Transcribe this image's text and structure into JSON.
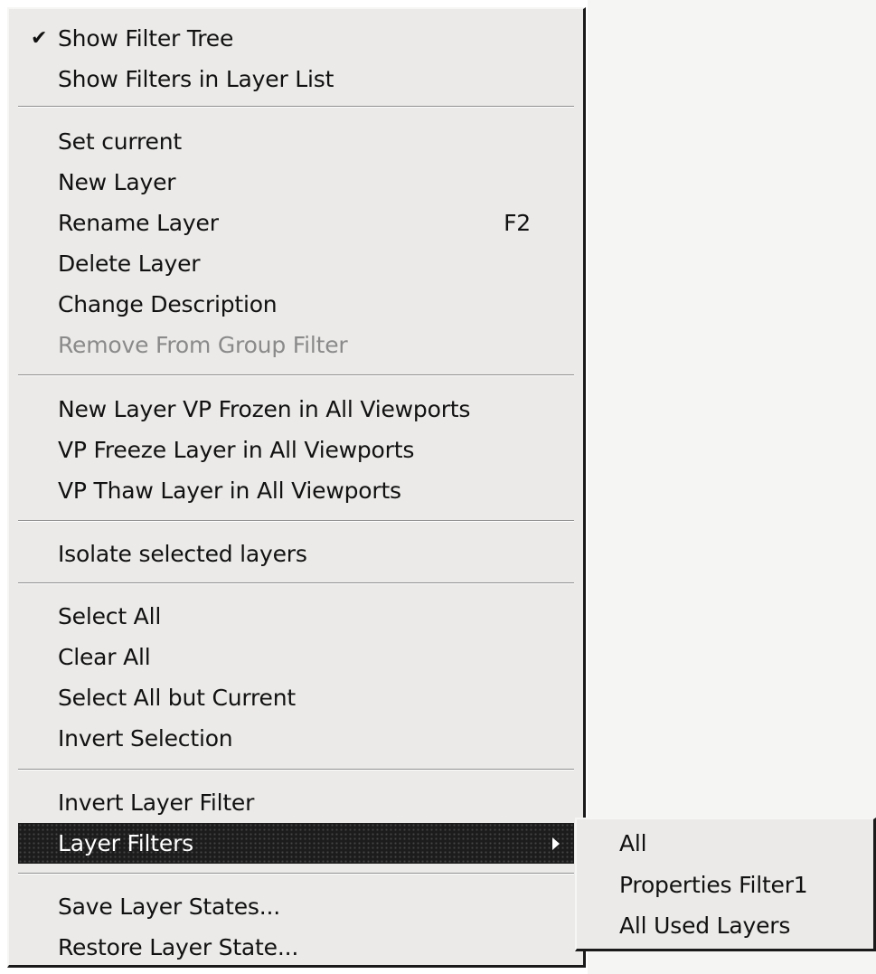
{
  "context_menu": {
    "groups": [
      [
        {
          "label": "Show Filter Tree",
          "checked": true
        },
        {
          "label": "Show Filters in Layer List"
        }
      ],
      [
        {
          "label": "Set current"
        },
        {
          "label": "New Layer"
        },
        {
          "label": "Rename Layer",
          "shortcut": "F2"
        },
        {
          "label": "Delete Layer"
        },
        {
          "label": "Change Description"
        },
        {
          "label": "Remove From Group Filter",
          "disabled": true
        }
      ],
      [
        {
          "label": "New Layer VP Frozen in All Viewports"
        },
        {
          "label": "VP Freeze Layer in All Viewports"
        },
        {
          "label": "VP Thaw Layer in All Viewports"
        }
      ],
      [
        {
          "label": "Isolate selected layers"
        }
      ],
      [
        {
          "label": "Select All"
        },
        {
          "label": "Clear All"
        },
        {
          "label": "Select All but Current"
        },
        {
          "label": "Invert Selection"
        }
      ],
      [
        {
          "label": "Invert Layer Filter"
        },
        {
          "label": "Layer Filters",
          "highlighted": true,
          "has_submenu": true
        }
      ],
      [
        {
          "label": "Save Layer States..."
        },
        {
          "label": "Restore Layer State..."
        }
      ]
    ],
    "checkmark": "✔"
  },
  "submenu": {
    "items": [
      {
        "label": "All"
      },
      {
        "label": "Properties Filter1"
      },
      {
        "label": "All Used Layers"
      }
    ]
  },
  "colors": {
    "menu_background": "#ebeae8",
    "highlight_background": "#1c1c1c",
    "highlight_text": "#ffffff",
    "disabled_text": "#8a8a8a"
  }
}
